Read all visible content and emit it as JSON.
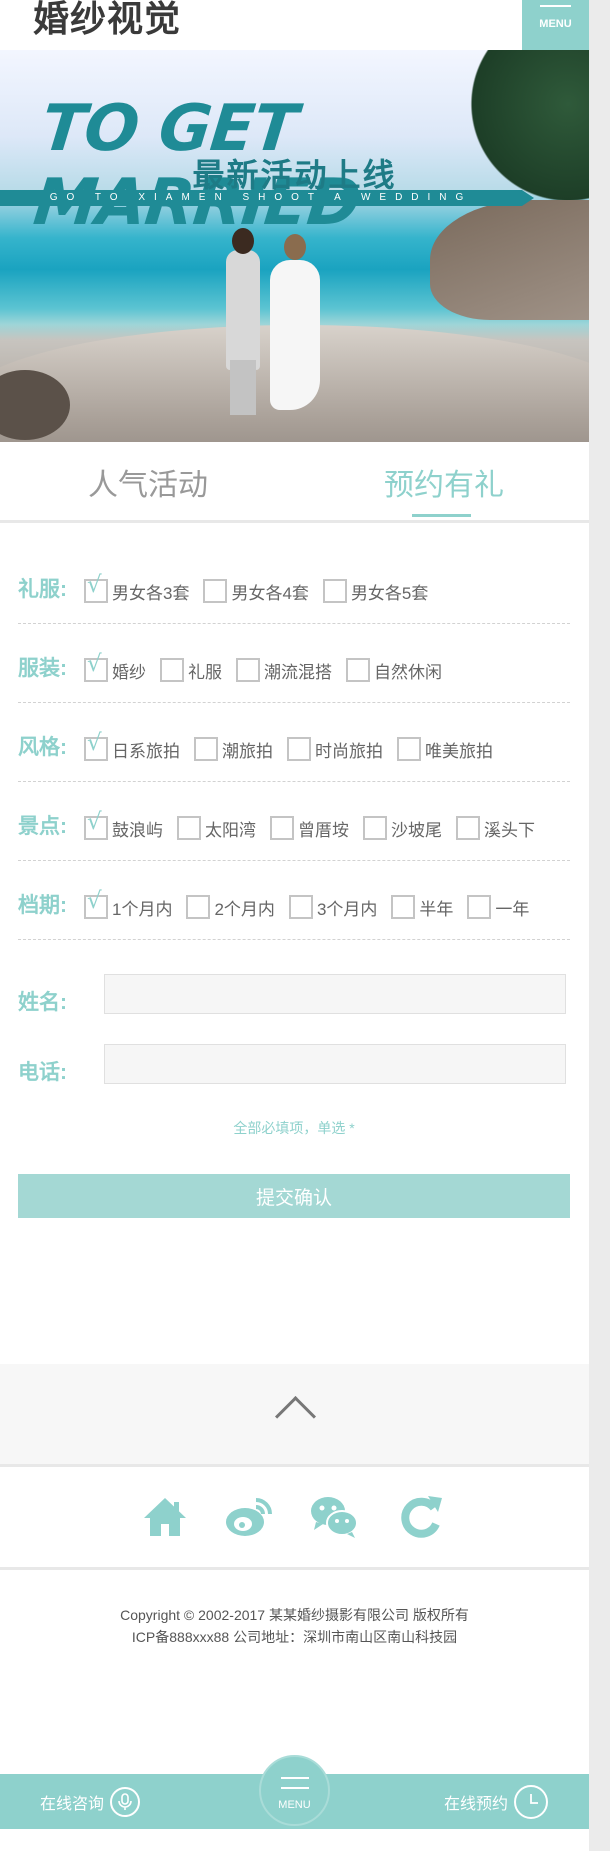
{
  "header": {
    "logo": "婚纱视觉",
    "menu_label": "MENU"
  },
  "banner": {
    "title": "TO GET MARRIED",
    "subtitle": "最新活动上线",
    "strip": "GO TO XIAMEN SHOOT A WEDDING"
  },
  "tabs": [
    {
      "label": "人气活动",
      "active": false
    },
    {
      "label": "预约有礼",
      "active": true
    }
  ],
  "form": {
    "groups": [
      {
        "label": "礼服:",
        "options": [
          {
            "label": "男女各3套",
            "checked": true
          },
          {
            "label": "男女各4套",
            "checked": false
          },
          {
            "label": "男女各5套",
            "checked": false
          }
        ]
      },
      {
        "label": "服装:",
        "options": [
          {
            "label": "婚纱",
            "checked": true
          },
          {
            "label": "礼服",
            "checked": false
          },
          {
            "label": "潮流混搭",
            "checked": false
          },
          {
            "label": "自然休闲",
            "checked": false
          }
        ]
      },
      {
        "label": "风格:",
        "options": [
          {
            "label": "日系旅拍",
            "checked": true
          },
          {
            "label": "潮旅拍",
            "checked": false
          },
          {
            "label": "时尚旅拍",
            "checked": false
          },
          {
            "label": "唯美旅拍",
            "checked": false
          }
        ]
      },
      {
        "label": "景点:",
        "options": [
          {
            "label": "鼓浪屿",
            "checked": true
          },
          {
            "label": "太阳湾",
            "checked": false
          },
          {
            "label": "曾厝垵",
            "checked": false
          },
          {
            "label": "沙坡尾",
            "checked": false
          },
          {
            "label": "溪头下",
            "checked": false
          }
        ]
      },
      {
        "label": "档期:",
        "options": [
          {
            "label": "1个月内",
            "checked": true
          },
          {
            "label": "2个月内",
            "checked": false
          },
          {
            "label": "3个月内",
            "checked": false
          },
          {
            "label": "半年",
            "checked": false
          },
          {
            "label": "一年",
            "checked": false
          }
        ]
      }
    ],
    "name_label": "姓名:",
    "name_value": "",
    "phone_label": "电话:",
    "phone_value": "",
    "note": "全部必填项，单选 *",
    "submit_label": "提交确认"
  },
  "social_icons": [
    "home-icon",
    "weibo-icon",
    "wechat-icon",
    "refresh-icon"
  ],
  "footer": {
    "copyright": "Copyright © 2002-2017 某某婚纱摄影有限公司 版权所有",
    "icp": "ICP备888xxx88 公司地址：深圳市南山区南山科技园"
  },
  "bottom_bar": {
    "consult_label": "在线咨询",
    "menu_label": "MENU",
    "booking_label": "在线预约"
  },
  "colors": {
    "accent": "#8ed1cc",
    "accent_light": "#a4d8d4",
    "text": "#555555"
  }
}
